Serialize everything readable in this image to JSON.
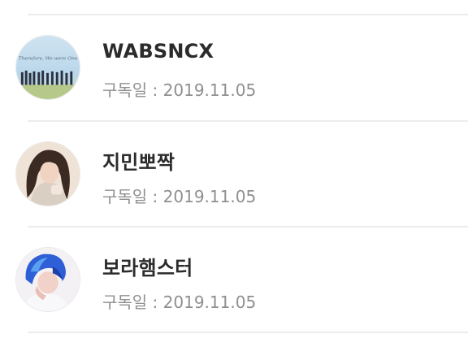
{
  "subscribers": [
    {
      "name": "WABSNCX",
      "date_label": "구독일 : ",
      "date": "2019.11.05",
      "avatar_icon": "group-photo-avatar",
      "avatar_caption": "Therefore, We were One"
    },
    {
      "name": "지민뽀짝",
      "date_label": "구독일 : ",
      "date": "2019.11.05",
      "avatar_icon": "portrait-avatar"
    },
    {
      "name": "보라햄스터",
      "date_label": "구독일 : ",
      "date": "2019.11.05",
      "avatar_icon": "blue-hair-portrait-avatar"
    }
  ]
}
